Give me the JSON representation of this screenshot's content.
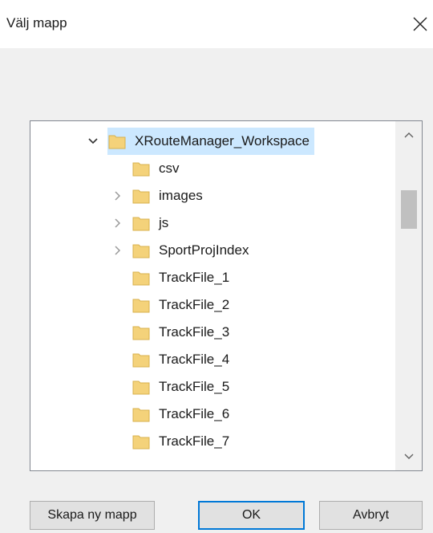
{
  "window": {
    "title": "Välj mapp"
  },
  "tree": {
    "root": {
      "label": "XRouteManager_Workspace",
      "expanded": true,
      "selected": true
    },
    "children": [
      {
        "label": "csv",
        "has_children": false
      },
      {
        "label": "images",
        "has_children": true
      },
      {
        "label": "js",
        "has_children": true
      },
      {
        "label": "SportProjIndex",
        "has_children": true
      },
      {
        "label": "TrackFile_1",
        "has_children": false
      },
      {
        "label": "TrackFile_2",
        "has_children": false
      },
      {
        "label": "TrackFile_3",
        "has_children": false
      },
      {
        "label": "TrackFile_4",
        "has_children": false
      },
      {
        "label": "TrackFile_5",
        "has_children": false
      },
      {
        "label": "TrackFile_6",
        "has_children": false
      },
      {
        "label": "TrackFile_7",
        "has_children": false
      }
    ]
  },
  "buttons": {
    "new_folder": "Skapa ny mapp",
    "ok": "OK",
    "cancel": "Avbryt"
  },
  "colors": {
    "selection": "#cce8ff",
    "folder": "#f4d27a",
    "ok_border": "#0078d7"
  }
}
